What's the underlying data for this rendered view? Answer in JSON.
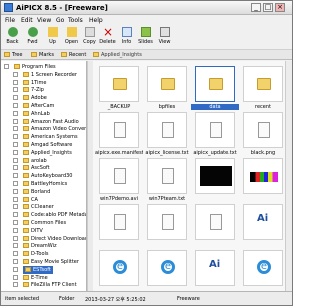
{
  "window": {
    "title": "AiPICX 8.5 - [Freeware]",
    "minimize": "_",
    "maximize": "□",
    "close": "×"
  },
  "menu": [
    "File",
    "Edit",
    "View",
    "Go",
    "Tools",
    "Help"
  ],
  "toolbar": [
    {
      "label": "Back",
      "icon": "back-icon"
    },
    {
      "label": "Fwd",
      "icon": "forward-icon"
    },
    {
      "label": "Up",
      "icon": "up-icon"
    },
    {
      "label": "Open",
      "icon": "open-icon"
    },
    {
      "label": "Copy",
      "icon": "copy-icon"
    },
    {
      "label": "Delete",
      "icon": "delete-icon"
    },
    {
      "label": "Info",
      "icon": "info-icon"
    },
    {
      "label": "Slides",
      "icon": "slides-icon"
    },
    {
      "label": "View",
      "icon": "view-icon"
    }
  ],
  "tabs": {
    "tree": "Tree",
    "marks": "Marks",
    "recent": "Recent",
    "path": "Applied_Insights"
  },
  "tree": [
    {
      "label": "Program Files",
      "depth": 0,
      "selected": false
    },
    {
      "label": "1 Screen Recorder",
      "depth": 1,
      "selected": false
    },
    {
      "label": "1Time",
      "depth": 1,
      "selected": false
    },
    {
      "label": "7-Zip",
      "depth": 1,
      "selected": false
    },
    {
      "label": "Adobe",
      "depth": 1,
      "selected": false
    },
    {
      "label": "AfterCam",
      "depth": 1,
      "selected": false
    },
    {
      "label": "AhnLab",
      "depth": 1,
      "selected": false
    },
    {
      "label": "Amazon Fast Audio",
      "depth": 1,
      "selected": false
    },
    {
      "label": "Amazon Video Converter",
      "depth": 1,
      "selected": false
    },
    {
      "label": "American Systems",
      "depth": 1,
      "selected": false
    },
    {
      "label": "Amgad Software",
      "depth": 1,
      "selected": false
    },
    {
      "label": "Applied_Insights",
      "depth": 1,
      "selected": false
    },
    {
      "label": "arolab",
      "depth": 1,
      "selected": false
    },
    {
      "label": "AscSoft",
      "depth": 1,
      "selected": false
    },
    {
      "label": "AutoKeyboard30",
      "depth": 1,
      "selected": false
    },
    {
      "label": "BattleyHomics",
      "depth": 1,
      "selected": false
    },
    {
      "label": "Borland",
      "depth": 1,
      "selected": false
    },
    {
      "label": "CA",
      "depth": 1,
      "selected": false
    },
    {
      "label": "CCleaner",
      "depth": 1,
      "selected": false
    },
    {
      "label": "Code:ablo PDF Metadata",
      "depth": 1,
      "selected": false
    },
    {
      "label": "Common Files",
      "depth": 1,
      "selected": false
    },
    {
      "label": "DITV",
      "depth": 1,
      "selected": false
    },
    {
      "label": "Direct Video Downloader",
      "depth": 1,
      "selected": false
    },
    {
      "label": "DreamWiz",
      "depth": 1,
      "selected": false
    },
    {
      "label": "D-Tools",
      "depth": 1,
      "selected": false
    },
    {
      "label": "Easy Movie Splitter",
      "depth": 1,
      "selected": false
    },
    {
      "label": "ESTsoft",
      "depth": 1,
      "selected": true
    },
    {
      "label": "E-Time",
      "depth": 1,
      "selected": false
    },
    {
      "label": "FileZilla FTP Client",
      "depth": 1,
      "selected": false
    }
  ],
  "thumbs": [
    {
      "name": "_BACKUP",
      "kind": "folder"
    },
    {
      "name": "bpfiles",
      "kind": "folder"
    },
    {
      "name": "data",
      "kind": "folder",
      "selected": true
    },
    {
      "name": "recent",
      "kind": "folder"
    },
    {
      "name": "aipicx.exe.manifest",
      "kind": "doc"
    },
    {
      "name": "aipicx_license.txt",
      "kind": "doc"
    },
    {
      "name": "aipicx_update.txt",
      "kind": "doc"
    },
    {
      "name": "black.png",
      "kind": "image"
    },
    {
      "name": "win7Pdemo.avi",
      "kind": "doc"
    },
    {
      "name": "win7Pteam.txt",
      "kind": "doc"
    },
    {
      "name": "",
      "kind": "black"
    },
    {
      "name": "",
      "kind": "color"
    },
    {
      "name": "",
      "kind": "doc"
    },
    {
      "name": "",
      "kind": "doc"
    },
    {
      "name": "",
      "kind": "doc"
    },
    {
      "name": "",
      "kind": "ai"
    },
    {
      "name": "",
      "kind": "ie"
    },
    {
      "name": "",
      "kind": "ie"
    },
    {
      "name": "",
      "kind": "ai"
    },
    {
      "name": "",
      "kind": "ie"
    }
  ],
  "status": {
    "selected": "item selected",
    "folder": "Folder",
    "date": "2013-03-27 오후 5:25:02",
    "license": "Freeware"
  }
}
